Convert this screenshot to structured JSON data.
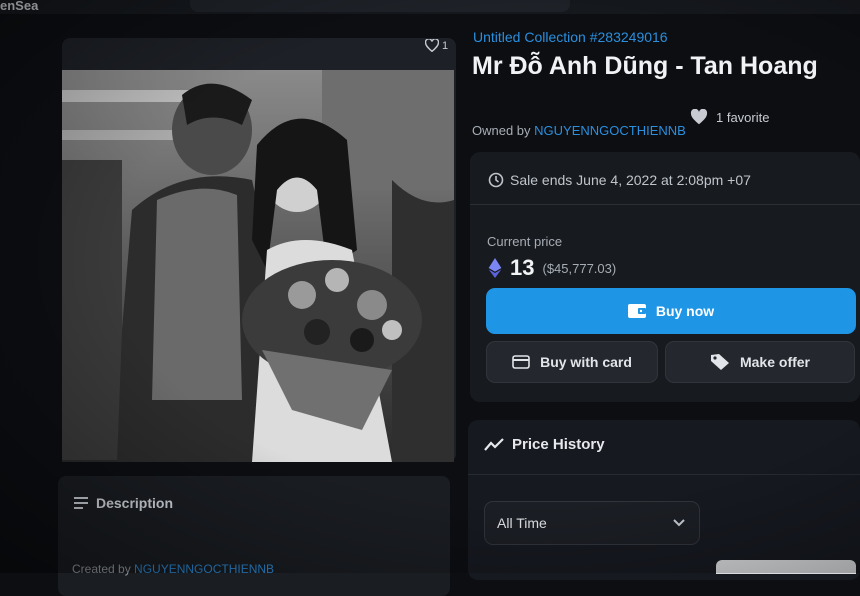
{
  "header": {
    "logo": "enSea"
  },
  "media": {
    "favorite_count": "1"
  },
  "asset": {
    "collection": "Untitled Collection #283249016",
    "title": "Mr Đỗ Anh Dũng - Tan Hoang",
    "owned_prefix": "Owned by ",
    "owner": "NGUYENNGOCTHIENNB",
    "favorites": "1 favorite"
  },
  "sale": {
    "ends": "Sale ends June 4, 2022 at 2:08pm +07",
    "price_label": "Current price",
    "price_eth": "13",
    "price_usd": "($45,777.03)",
    "buy_now": "Buy now",
    "buy_with_card": "Buy with card",
    "make_offer": "Make offer"
  },
  "description": {
    "title": "Description",
    "created_prefix": "Created by ",
    "creator": "NGUYENNGOCTHIENNB"
  },
  "price_history": {
    "title": "Price History",
    "range_selected": "All Time"
  },
  "icons": {
    "heart": "heart-icon",
    "clock": "clock-icon",
    "eth": "ethereum-icon",
    "wallet": "wallet-icon",
    "card": "credit-card-icon",
    "tag": "tag-icon",
    "chart": "trend-icon",
    "list": "list-icon",
    "chevron": "chevron-down-icon"
  },
  "colors": {
    "accent": "#2b8fde",
    "buy_button": "#1f95e6"
  }
}
